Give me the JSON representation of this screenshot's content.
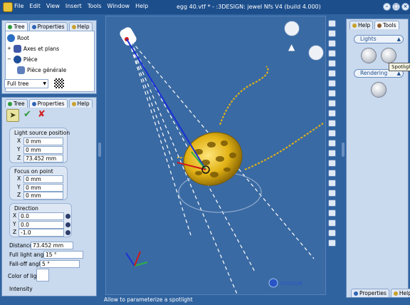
{
  "app": {
    "window_title": "egg 40.vtf * - :3DESIGN: jewel Nfs V4 (build 4.000)",
    "menu": [
      "File",
      "Edit",
      "View",
      "Insert",
      "Tools",
      "Window",
      "Help"
    ]
  },
  "top_panel": {
    "tabs": [
      "Tree",
      "Properties",
      "Help"
    ],
    "tree_items": [
      "Root",
      "Axes et plans",
      "Pièce",
      "Pièce générale"
    ],
    "tree_filter": "Full tree"
  },
  "bottom_panel": {
    "tabs": [
      "Tree",
      "Properties",
      "Help"
    ],
    "light_source": {
      "title": "Light source position",
      "x_label": "X",
      "x": "0 mm",
      "y_label": "Y",
      "y": "0 mm",
      "z_label": "Z",
      "z": "73.452 mm"
    },
    "focus": {
      "title": "Focus on point",
      "x_label": "X",
      "x": "0 mm",
      "y_label": "Y",
      "y": "0 mm",
      "z_label": "Z",
      "z": "0 mm"
    },
    "direction": {
      "title": "Direction",
      "x_label": "X",
      "x": "0.0",
      "y_label": "Y",
      "y": "0.0",
      "z_label": "Z",
      "z": "-1.0"
    },
    "distance_label": "Distance",
    "distance": "73.452 mm",
    "full_light_label": "Full light angle",
    "full_light": "15 °",
    "falloff_label": "Fall-off angle",
    "falloff": "5 °",
    "color_label": "Color of light",
    "intensity_label": "Intensity"
  },
  "viewport": {
    "logo_text": "3DESIGN"
  },
  "status": "Allow to parameterize a spotlight",
  "right_panel": {
    "tabs": [
      "Help",
      "Tools"
    ],
    "lights_label": "Lights",
    "rendering_label": "Rendering",
    "tooltip": "Spotlight",
    "bottom_tabs": [
      "Properties",
      "Help"
    ]
  },
  "colors": {
    "title_bar": "#1c4e8c",
    "background": "#2f63a0",
    "panel": "#c9d9ee",
    "gold": "#e2b215"
  }
}
